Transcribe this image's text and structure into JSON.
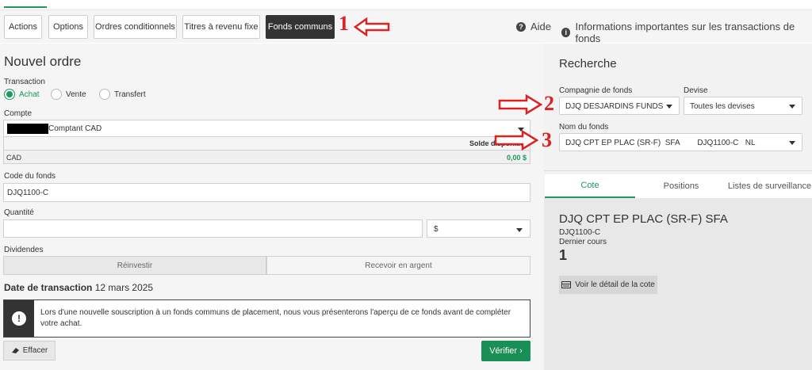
{
  "tabs": [
    {
      "label": "Actions"
    },
    {
      "label": "Options"
    },
    {
      "label": "Ordres conditionnels"
    },
    {
      "label": "Titres à revenu fixe"
    },
    {
      "label": "Fonds communs"
    }
  ],
  "annotations": [
    "1",
    "2",
    "3"
  ],
  "header": {
    "help_label": "Aide",
    "info_label": "Informations importantes sur les transactions de fonds"
  },
  "order": {
    "title": "Nouvel ordre",
    "transaction_label": "Transaction",
    "transaction_options": [
      "Achat",
      "Vente",
      "Transfert"
    ],
    "transaction_selected": "Achat",
    "account_label": "Compte",
    "account_value": "Comptant CAD",
    "balance_label": "Solde disponible",
    "currency": "CAD",
    "balance_value": "0,00 $",
    "fund_code_label": "Code du fonds",
    "fund_code_value": "DJQ1100-C",
    "quantity_label": "Quantité",
    "quantity_value": "",
    "unit_value": "$",
    "dividends_label": "Dividendes",
    "reinvest_label": "Réinvestir",
    "receive_cash_label": "Recevoir en argent",
    "trade_date_label": "Date de transaction",
    "trade_date_value": "12 mars 2025",
    "notice_text": "Lors d'une nouvelle souscription à un fonds communs de placement, nous vous présenterons l'aperçu de ce fonds avant de compléter votre achat.",
    "clear_label": "Effacer",
    "verify_label": "Vérifier"
  },
  "search": {
    "title": "Recherche",
    "company_label": "Compagnie de fonds",
    "company_value": "DJQ DESJARDINS FUNDS",
    "currency_label": "Devise",
    "currency_value": "Toutes les devises",
    "fund_name_label": "Nom du fonds",
    "fund_name_value": "DJQ CPT EP PLAC (SR-F)  SFA        DJQ1100-C   NL"
  },
  "quote_tabs": [
    {
      "label": "Cote"
    },
    {
      "label": "Positions"
    },
    {
      "label": "Listes de surveillance"
    }
  ],
  "quote": {
    "fund_name": "DJQ CPT EP PLAC (SR-F) SFA",
    "fund_code": "DJQ1100-C",
    "last_price_label": "Dernier cours",
    "last_price_value": "1",
    "detail_label": "Voir le détail de la cote"
  },
  "colors": {
    "accent": "#1a9a5b",
    "annotation": "#dd2222",
    "dark": "#333333"
  }
}
